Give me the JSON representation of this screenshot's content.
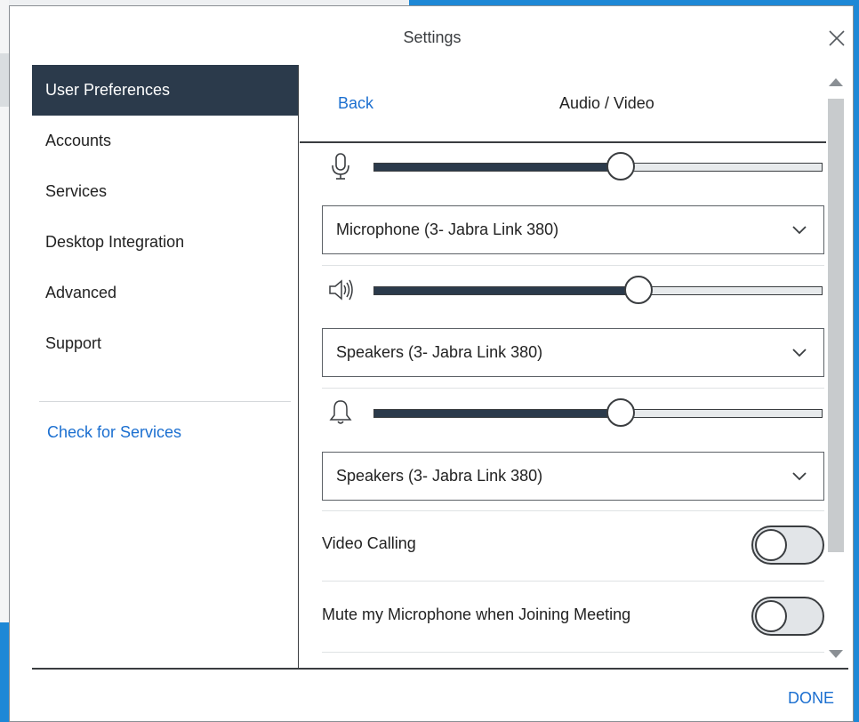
{
  "dialog": {
    "title": "Settings",
    "close_icon": "close-x-icon",
    "done_label": "DONE"
  },
  "sidebar": {
    "items": [
      {
        "label": "User Preferences",
        "active": true
      },
      {
        "label": "Accounts"
      },
      {
        "label": "Services"
      },
      {
        "label": "Desktop Integration"
      },
      {
        "label": "Advanced"
      },
      {
        "label": "Support"
      }
    ],
    "check_services_label": "Check for Services"
  },
  "panel": {
    "back_label": "Back",
    "title": "Audio / Video",
    "microphone": {
      "icon": "microphone-icon",
      "volume_percent": 55,
      "device": "Microphone (3- Jabra Link 380)"
    },
    "speaker": {
      "icon": "speaker-icon",
      "volume_percent": 59,
      "device": "Speakers (3- Jabra Link 380)"
    },
    "ringer": {
      "icon": "bell-icon",
      "volume_percent": 55,
      "device": "Speakers (3- Jabra Link 380)"
    },
    "toggles": [
      {
        "label": "Video Calling",
        "on": false
      },
      {
        "label": "Mute my Microphone when Joining Meeting",
        "on": false
      }
    ]
  },
  "colors": {
    "accent": "#1b6fd0",
    "active_nav_bg": "#2b3a4b",
    "slider_fill": "#2b3a4b"
  }
}
